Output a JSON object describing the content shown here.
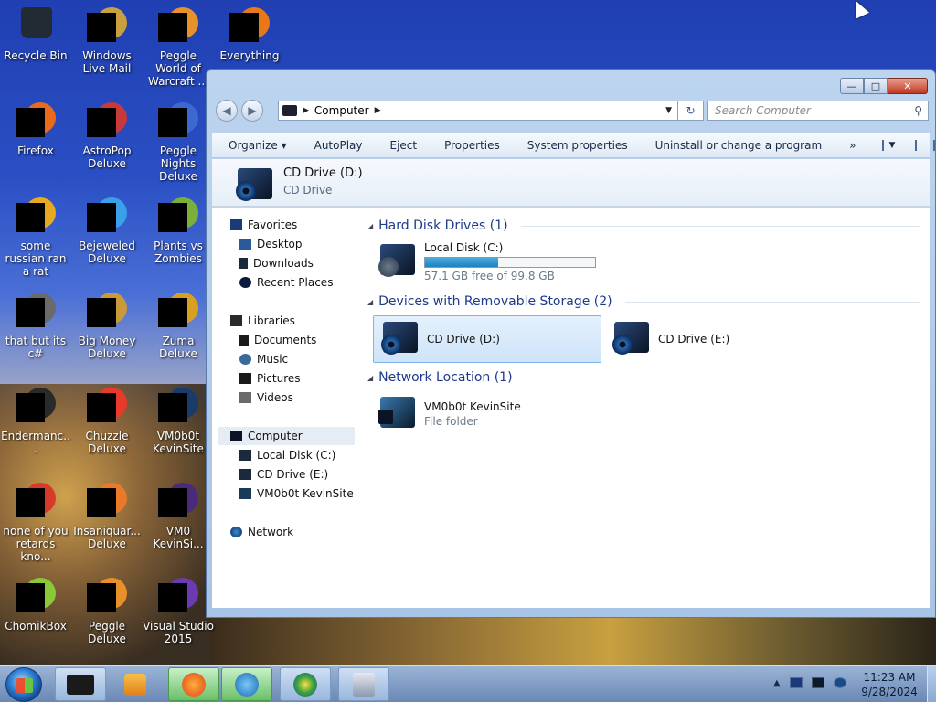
{
  "desktop": {
    "icons": [
      {
        "label": "Recycle Bin",
        "color": "#222a33"
      },
      {
        "label": "Windows Live Mail",
        "color": "#c8a040"
      },
      {
        "label": "Peggle World of Warcraft ...",
        "color": "#e8902a"
      },
      {
        "label": "Everything",
        "color": "#e87818"
      },
      {
        "label": "Firefox",
        "color": "#e86a1a"
      },
      {
        "label": "AstroPop Deluxe",
        "color": "#c83a3a"
      },
      {
        "label": "Peggle Nights Deluxe",
        "color": "#3a6ad0"
      },
      {
        "label": "some russian ran a rat",
        "color": "#e8a820"
      },
      {
        "label": "Bejeweled Deluxe",
        "color": "#3aa0e8"
      },
      {
        "label": "Plants vs Zombies",
        "color": "#7ab03a"
      },
      {
        "label": "that but its c#",
        "color": "#6a6a6a"
      },
      {
        "label": "Big Money Deluxe",
        "color": "#c89a3a"
      },
      {
        "label": "Zuma Deluxe",
        "color": "#d8a020"
      },
      {
        "label": "Endermanc...",
        "color": "#2a2a2a"
      },
      {
        "label": "Chuzzle Deluxe",
        "color": "#e83a2a"
      },
      {
        "label": "VM0b0t KevinSite",
        "color": "#1a3a6a"
      },
      {
        "label": "none of you retards kno...",
        "color": "#d83a2a"
      },
      {
        "label": "Insaniquar... Deluxe",
        "color": "#e87a2a"
      },
      {
        "label": "VM0 KevinSi...",
        "color": "#4a2a7a"
      },
      {
        "label": "ChomikBox",
        "color": "#8ac83a"
      },
      {
        "label": "Peggle Deluxe",
        "color": "#e8902a"
      },
      {
        "label": "Visual Studio 2015",
        "color": "#6a3ab0"
      }
    ]
  },
  "explorer": {
    "controls": {
      "minimize": "—",
      "maximize": "□",
      "close": "✕"
    },
    "nav": {
      "back": "◀",
      "forward": "▶"
    },
    "address": {
      "crumb": "Computer",
      "arrow": "▶",
      "refresh": "↻"
    },
    "search": {
      "placeholder": "Search Computer",
      "icon": "⚲"
    },
    "toolbar": [
      "Organize ▾",
      "AutoPlay",
      "Eject",
      "Properties",
      "System properties",
      "Uninstall or change a program",
      "»"
    ],
    "details": {
      "title": "CD Drive (D:)",
      "subtitle": "CD Drive"
    },
    "navpane": {
      "favorites": "Favorites",
      "fav_items": [
        "Desktop",
        "Downloads",
        "Recent Places"
      ],
      "libraries": "Libraries",
      "lib_items": [
        "Documents",
        "Music",
        "Pictures",
        "Videos"
      ],
      "computer": "Computer",
      "comp_items": [
        "Local Disk (C:)",
        "CD Drive (E:)",
        "VM0b0t KevinSite"
      ],
      "network": "Network"
    },
    "groups": {
      "hdd": "Hard Disk Drives (1)",
      "removable": "Devices with Removable Storage (2)",
      "network": "Network Location (1)"
    },
    "items": {
      "c_name": "Local Disk (C:)",
      "c_free": "57.1 GB free of 99.8 GB",
      "c_used_fraction": 0.428,
      "d_name": "CD Drive (D:)",
      "e_name": "CD Drive (E:)",
      "net_name": "VM0b0t KevinSite",
      "net_type": "File folder"
    }
  },
  "taskbar": {
    "time": "11:23 AM",
    "date": "9/28/2024",
    "tray_arrow": "▲"
  }
}
